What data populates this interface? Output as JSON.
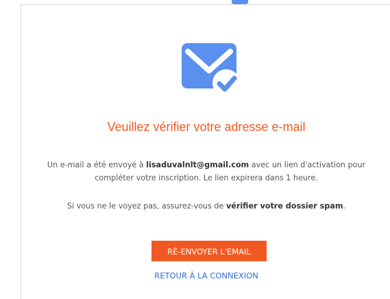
{
  "colors": {
    "accent": "#f05a22",
    "link": "#2f6fd6",
    "icon_blue": "#5b8ff0"
  },
  "icon": "envelope-check-icon",
  "title": "Veuillez vérifier votre adresse e-mail",
  "message1": {
    "prefix": "Un e-mail a été envoyé à ",
    "email": "lisaduvalnlt@gmail.com",
    "suffix_line1": " avec un lien d'activation pour",
    "line2": "compléter votre inscription. Le lien expirera dans 1 heure."
  },
  "message2": {
    "prefix": "Si vous ne le voyez pas, assurez-vous de ",
    "bold": "vérifier votre dossier spam",
    "suffix": "."
  },
  "resend_button": "RÉ-ENVOYER L'EMAIL",
  "back_link": "RETOUR À LA CONNEXION"
}
